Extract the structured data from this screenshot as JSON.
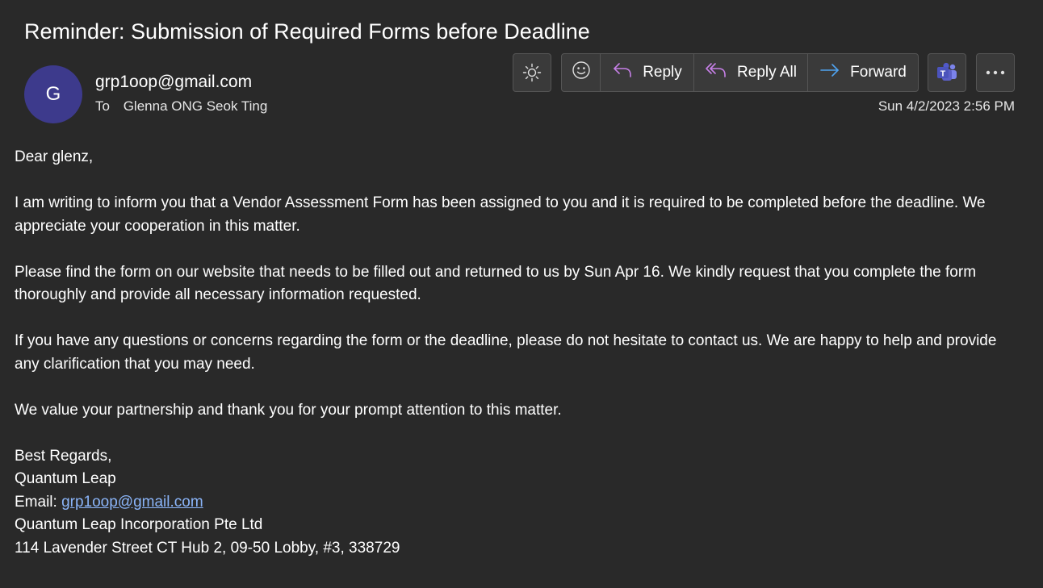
{
  "email": {
    "subject": "Reminder: Submission of Required Forms before Deadline",
    "avatar_initial": "G",
    "sender": "grp1oop@gmail.com",
    "to_label": "To",
    "recipient": "Glenna ONG Seok Ting",
    "date": "Sun 4/2/2023 2:56 PM"
  },
  "toolbar": {
    "theme_icon": "sun-icon",
    "emoji_icon": "smiley-icon",
    "reply_label": "Reply",
    "reply_all_label": "Reply All",
    "forward_label": "Forward",
    "teams_icon": "teams-icon",
    "more_icon": "ellipsis-icon"
  },
  "body": {
    "greeting": "Dear glenz,",
    "paragraph1": "I am writing to inform you that a Vendor Assessment Form has been assigned to you and it is required to be completed before the deadline. We appreciate your cooperation in this matter.",
    "paragraph2": "Please find the form on our website that needs to be filled out and returned to us by Sun Apr 16. We kindly request that you complete the form thoroughly and provide all necessary information requested.",
    "paragraph3": "If you have any questions or concerns regarding the form or the deadline, please do not hesitate to contact us. We are happy to help and provide any clarification that you may need.",
    "paragraph4": "We value your partnership and thank you for your prompt attention to this matter."
  },
  "signature": {
    "closing": "Best Regards,",
    "name": "Quantum Leap",
    "email_label": "Email: ",
    "email_link": "grp1oop@gmail.com",
    "company": "Quantum Leap Incorporation Pte Ltd",
    "address": "114 Lavender Street CT Hub 2, 09-50 Lobby, #3, 338729"
  },
  "colors": {
    "background": "#292929",
    "avatar": "#3d3a8c",
    "link": "#8ab4f8",
    "reply_icon": "#c780e8",
    "forward_icon": "#4fa3f0"
  }
}
